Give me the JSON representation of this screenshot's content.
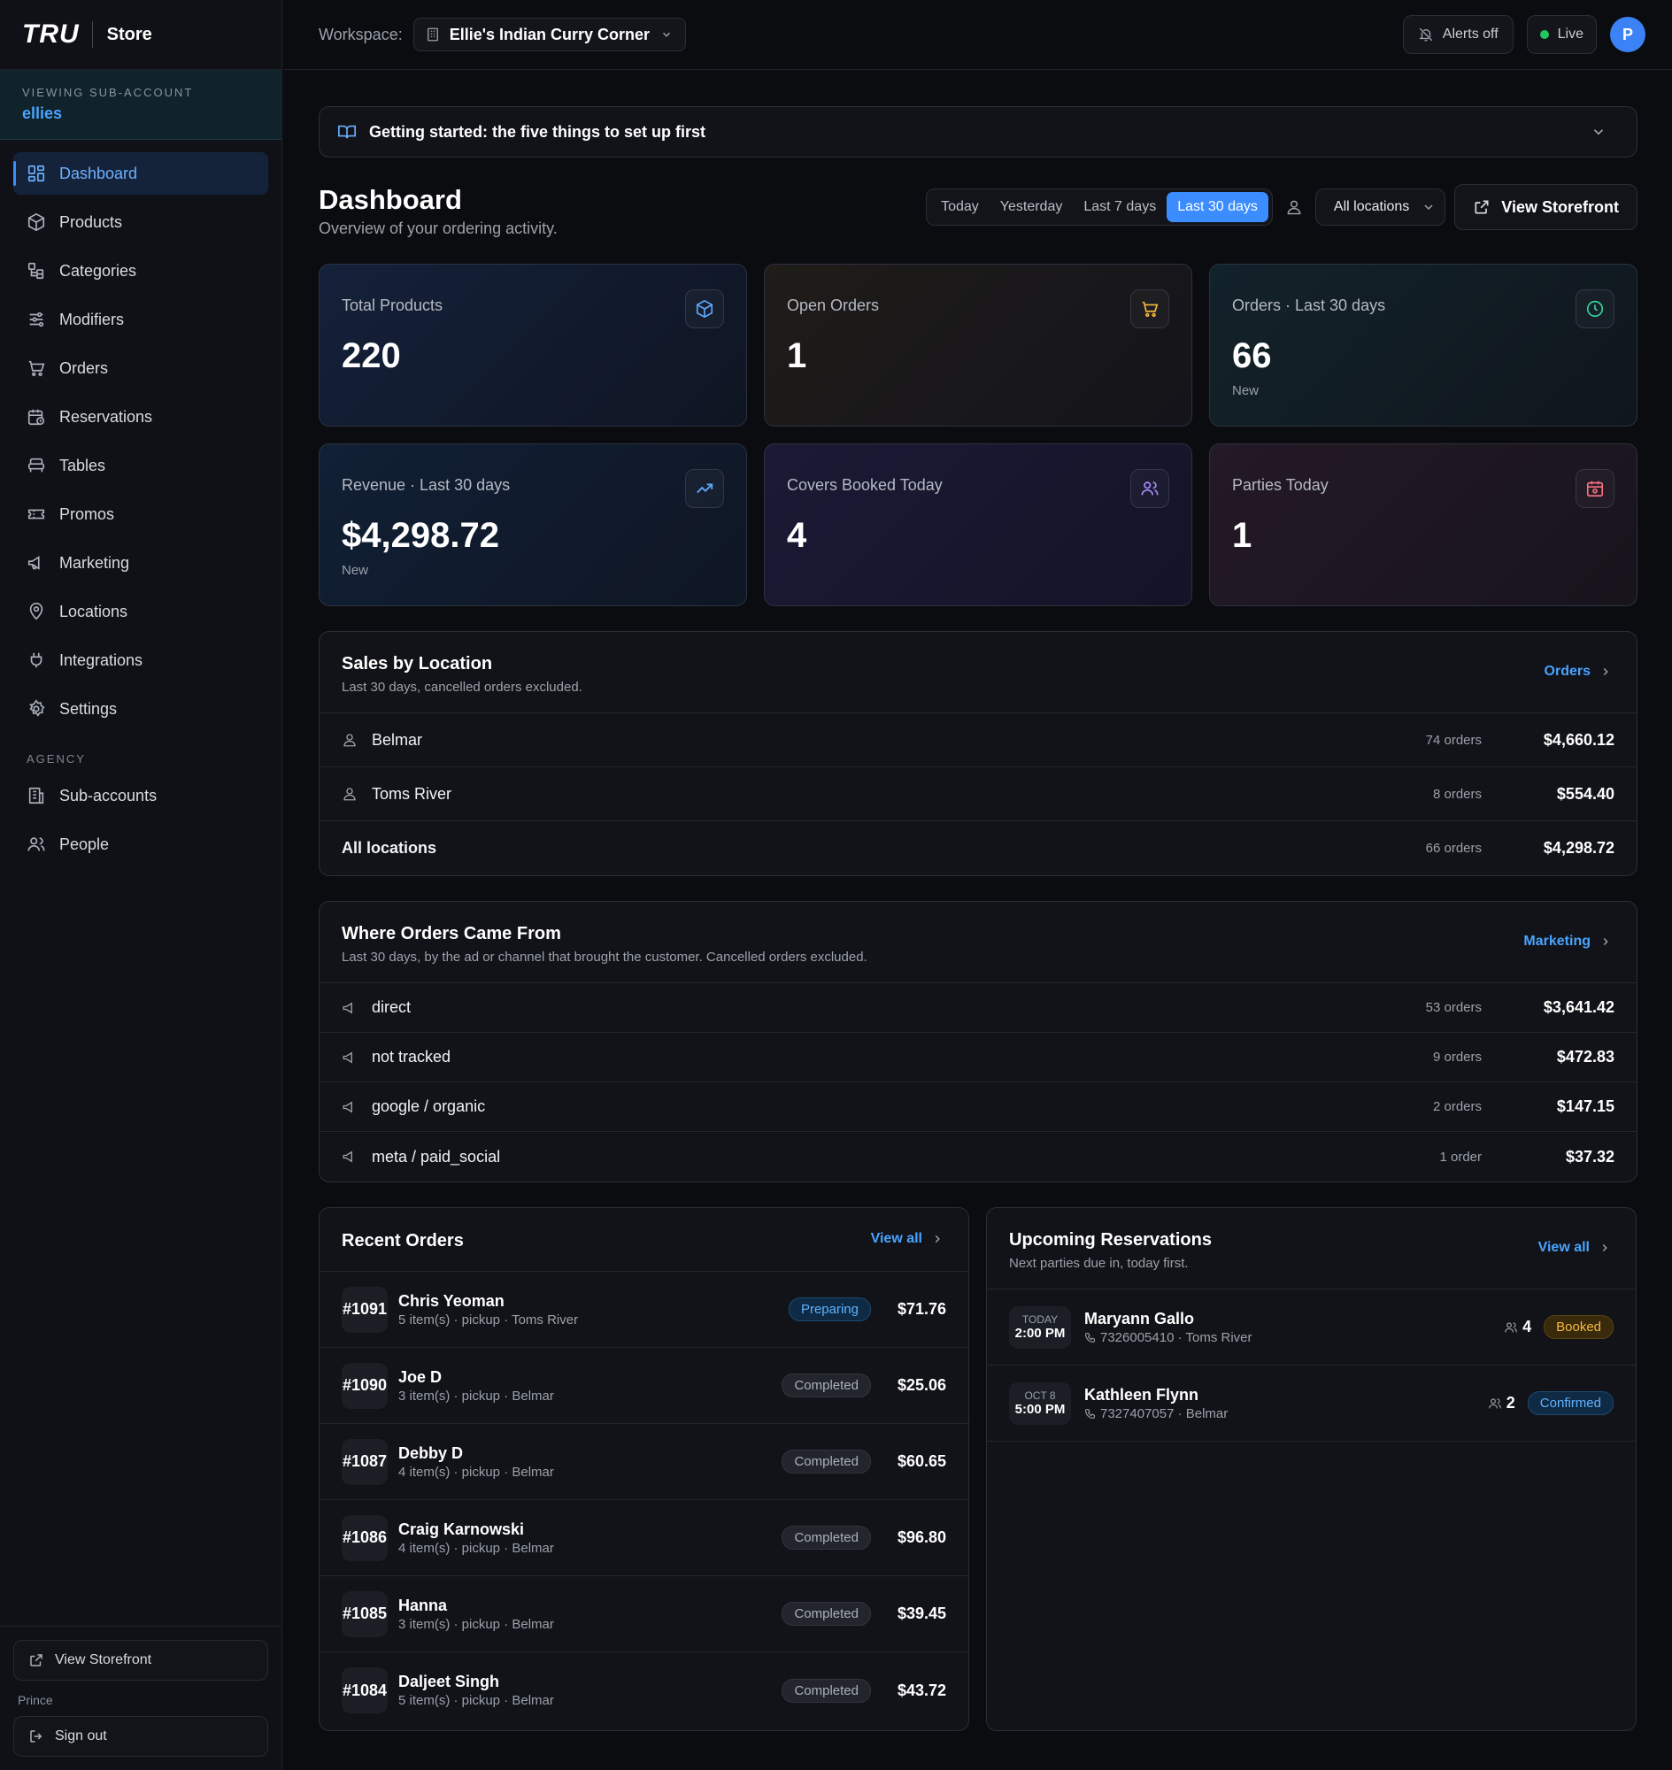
{
  "brand": {
    "logo": "TRU",
    "product": "Store"
  },
  "subaccount": {
    "label": "VIEWING SUB-ACCOUNT",
    "name": "ellies"
  },
  "nav": {
    "items": [
      {
        "label": "Dashboard",
        "icon": "dashboard-icon",
        "active": true
      },
      {
        "label": "Products",
        "icon": "box-icon"
      },
      {
        "label": "Categories",
        "icon": "categories-icon"
      },
      {
        "label": "Modifiers",
        "icon": "sliders-icon"
      },
      {
        "label": "Orders",
        "icon": "cart-icon"
      },
      {
        "label": "Reservations",
        "icon": "calendar-clock-icon"
      },
      {
        "label": "Tables",
        "icon": "table-icon"
      },
      {
        "label": "Promos",
        "icon": "ticket-icon"
      },
      {
        "label": "Marketing",
        "icon": "megaphone-icon"
      },
      {
        "label": "Locations",
        "icon": "map-pin-icon"
      },
      {
        "label": "Integrations",
        "icon": "plug-icon"
      },
      {
        "label": "Settings",
        "icon": "gear-icon"
      }
    ],
    "agency_label": "AGENCY",
    "agency_items": [
      {
        "label": "Sub-accounts",
        "icon": "building-icon"
      },
      {
        "label": "People",
        "icon": "users-icon"
      }
    ]
  },
  "sidebar_footer": {
    "view_storefront": "View Storefront",
    "user": "Prince",
    "sign_out": "Sign out"
  },
  "topbar": {
    "workspace_label": "Workspace:",
    "workspace_name": "Ellie's Indian Curry Corner",
    "alerts": "Alerts off",
    "live": "Live",
    "avatar_initial": "P"
  },
  "banner": {
    "text": "Getting started: the five things to set up first"
  },
  "page": {
    "title": "Dashboard",
    "subtitle": "Overview of your ordering activity.",
    "ranges": [
      "Today",
      "Yesterday",
      "Last 7 days",
      "Last 30 days"
    ],
    "active_range": "Last 30 days",
    "location_select": "All locations",
    "view_storefront": "View Storefront"
  },
  "stats": [
    {
      "label": "Total Products",
      "value": "220",
      "note": "",
      "icon": "box-icon",
      "color": "#5fa8ff"
    },
    {
      "label": "Open Orders",
      "value": "1",
      "note": "",
      "icon": "cart-icon",
      "color": "#f5b942"
    },
    {
      "label": "Orders · Last 30 days",
      "value": "66",
      "note": "New",
      "icon": "clock-icon",
      "color": "#34d399"
    },
    {
      "label": "Revenue · Last 30 days",
      "value": "$4,298.72",
      "note": "New",
      "icon": "trending-up-icon",
      "color": "#5fa8ff"
    },
    {
      "label": "Covers Booked Today",
      "value": "4",
      "note": "",
      "icon": "users-icon",
      "color": "#a78bfa"
    },
    {
      "label": "Parties Today",
      "value": "1",
      "note": "",
      "icon": "calendar-icon",
      "color": "#fb7185"
    }
  ],
  "sales_by_location": {
    "title": "Sales by Location",
    "subtitle": "Last 30 days, cancelled orders excluded.",
    "link": "Orders",
    "rows": [
      {
        "name": "Belmar",
        "count": "74 orders",
        "amount": "$4,660.12"
      },
      {
        "name": "Toms River",
        "count": "8 orders",
        "amount": "$554.40"
      }
    ],
    "total": {
      "name": "All locations",
      "count": "66 orders",
      "amount": "$4,298.72"
    }
  },
  "order_sources": {
    "title": "Where Orders Came From",
    "subtitle": "Last 30 days, by the ad or channel that brought the customer. Cancelled orders excluded.",
    "link": "Marketing",
    "rows": [
      {
        "name": "direct",
        "count": "53 orders",
        "amount": "$3,641.42"
      },
      {
        "name": "not tracked",
        "count": "9 orders",
        "amount": "$472.83"
      },
      {
        "name": "google / organic",
        "count": "2 orders",
        "amount": "$147.15"
      },
      {
        "name": "meta / paid_social",
        "count": "1 order",
        "amount": "$37.32"
      }
    ]
  },
  "recent_orders": {
    "title": "Recent Orders",
    "link": "View all",
    "rows": [
      {
        "number": "#1091",
        "name": "Chris Yeoman",
        "meta": "5 item(s) · pickup · Toms River",
        "status": "Preparing",
        "total": "$71.76"
      },
      {
        "number": "#1090",
        "name": "Joe D",
        "meta": "3 item(s) · pickup · Belmar",
        "status": "Completed",
        "total": "$25.06"
      },
      {
        "number": "#1087",
        "name": "Debby D",
        "meta": "4 item(s) · pickup · Belmar",
        "status": "Completed",
        "total": "$60.65"
      },
      {
        "number": "#1086",
        "name": "Craig Karnowski",
        "meta": "4 item(s) · pickup · Belmar",
        "status": "Completed",
        "total": "$96.80"
      },
      {
        "number": "#1085",
        "name": "Hanna",
        "meta": "3 item(s) · pickup · Belmar",
        "status": "Completed",
        "total": "$39.45"
      },
      {
        "number": "#1084",
        "name": "Daljeet Singh",
        "meta": "5 item(s) · pickup · Belmar",
        "status": "Completed",
        "total": "$43.72"
      }
    ]
  },
  "reservations": {
    "title": "Upcoming Reservations",
    "subtitle": "Next parties due in, today first.",
    "link": "View all",
    "rows": [
      {
        "day": "TODAY",
        "time": "2:00 PM",
        "name": "Maryann Gallo",
        "meta": "7326005410 · Toms River",
        "party": "4",
        "status": "Booked"
      },
      {
        "day": "OCT 8",
        "time": "5:00 PM",
        "name": "Kathleen Flynn",
        "meta": "7327407057 · Belmar",
        "party": "2",
        "status": "Confirmed"
      }
    ]
  }
}
